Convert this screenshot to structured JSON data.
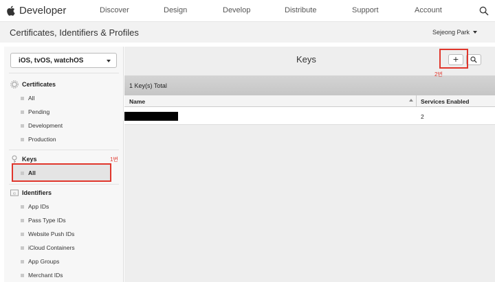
{
  "globalnav": {
    "brand": "Developer",
    "links": [
      "Discover",
      "Design",
      "Develop",
      "Distribute",
      "Support",
      "Account"
    ]
  },
  "header": {
    "title": "Certificates, Identifiers & Profiles",
    "user": "Sejeong Park"
  },
  "sidebar": {
    "platform": "iOS, tvOS, watchOS",
    "sections": [
      {
        "label": "Certificates",
        "icon": "gear-icon",
        "items": [
          "All",
          "Pending",
          "Development",
          "Production"
        ]
      },
      {
        "label": "Keys",
        "icon": "key-icon",
        "items": [
          "All"
        ],
        "active_item": "All"
      },
      {
        "label": "Identifiers",
        "icon": "id-icon",
        "items": [
          "App IDs",
          "Pass Type IDs",
          "Website Push IDs",
          "iCloud Containers",
          "App Groups",
          "Merchant IDs"
        ]
      }
    ]
  },
  "main": {
    "title": "Keys",
    "add_label": "+",
    "summary": "1 Key(s) Total",
    "columns": [
      "Name",
      "Services Enabled"
    ],
    "rows": [
      {
        "name": "",
        "services": "2"
      }
    ]
  },
  "annotations": {
    "step1": "1번",
    "step2": "2번",
    "color": "#e0352b"
  }
}
